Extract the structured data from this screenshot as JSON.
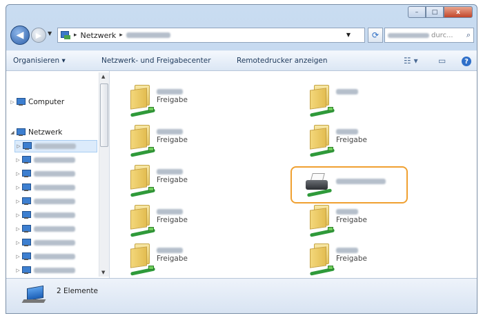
{
  "window": {
    "controls": {
      "minimize": "–",
      "maximize": "□",
      "close": "x"
    }
  },
  "nav": {
    "back_icon": "arrow-left",
    "forward_icon": "arrow-right",
    "breadcrumb": [
      "Netzwerk"
    ],
    "breadcrumb_sep": "▸",
    "search_placeholder": "durc...",
    "search_icon": "⌕",
    "refresh_icon": "⟳"
  },
  "toolbar": {
    "organize": "Organisieren ▾",
    "network_center": "Netzwerk- und Freigabecenter",
    "remote_printers": "Remotedrucker anzeigen",
    "help": "?"
  },
  "tree": {
    "computer": "Computer",
    "network": "Netzwerk"
  },
  "items": [
    {
      "type": "Freigabe",
      "icon": "shared-folder"
    },
    {
      "type": "Freigabe",
      "icon": "shared-folder"
    },
    {
      "type": "Freigabe",
      "icon": "shared-folder"
    },
    {
      "type": "Freigabe",
      "icon": "shared-folder"
    },
    {
      "type": "Freigabe",
      "icon": "shared-folder"
    },
    {
      "type": "",
      "icon": "shared-printer"
    },
    {
      "type": "Freigabe",
      "icon": "shared-folder"
    },
    {
      "type": "Freigabe",
      "icon": "shared-folder"
    },
    {
      "type": "Freigabe",
      "icon": "shared-folder"
    },
    {
      "type": "Freigabe",
      "icon": "shared-folder"
    }
  ],
  "status": {
    "count": "2 Elemente"
  },
  "colors": {
    "highlight": "#f0a030",
    "selection": "#dcebfb"
  }
}
